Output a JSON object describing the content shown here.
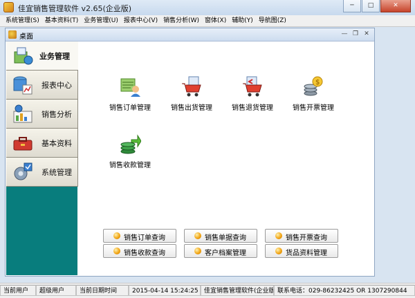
{
  "window": {
    "title": "佳宜销售管理软件 v2.65(企业版)",
    "min_icon": "minimize-icon",
    "max_icon": "maximize-icon",
    "close_icon": "close-icon"
  },
  "menu": [
    "系统管理(S)",
    "基本资料(T)",
    "业务管理(U)",
    "报表中心(V)",
    "销售分析(W)",
    "窗体(X)",
    "辅助(Y)",
    "导航图(Z)"
  ],
  "desktop": {
    "title": "桌面"
  },
  "sidebar": {
    "items": [
      {
        "label": "业务管理",
        "icon": "business-management-icon",
        "active": true
      },
      {
        "label": "报表中心",
        "icon": "report-center-icon",
        "active": false
      },
      {
        "label": "销售分析",
        "icon": "sales-analysis-icon",
        "active": false
      },
      {
        "label": "基本资料",
        "icon": "basic-data-icon",
        "active": false
      },
      {
        "label": "系统管理",
        "icon": "system-management-icon",
        "active": false
      }
    ]
  },
  "functions": [
    {
      "label": "销售订单管理",
      "icon": "sales-order-icon"
    },
    {
      "label": "销售出货管理",
      "icon": "sales-shipment-icon"
    },
    {
      "label": "销售退货管理",
      "icon": "sales-return-icon"
    },
    {
      "label": "销售开票管理",
      "icon": "sales-invoice-icon"
    },
    {
      "label": "销售收款管理",
      "icon": "sales-receipt-icon"
    }
  ],
  "quick_buttons": [
    "销售订单查询",
    "销售单据查询",
    "销售开票查询",
    "销售收款查询",
    "客户档案管理",
    "货品资料管理"
  ],
  "status": {
    "user_label": "当前用户",
    "user_value": "超级用户",
    "date_label": "当前日期时间",
    "date_value": "2015-04-14 15:24:25",
    "product": "佳宜销售管理软件(企业版)",
    "contact": "联系电话：029-86232425 OR 1307290844"
  },
  "colors": {
    "sidebar_bg": "#087d7d",
    "quick_dot": "#f2a516",
    "close_button": "#c7442b"
  }
}
